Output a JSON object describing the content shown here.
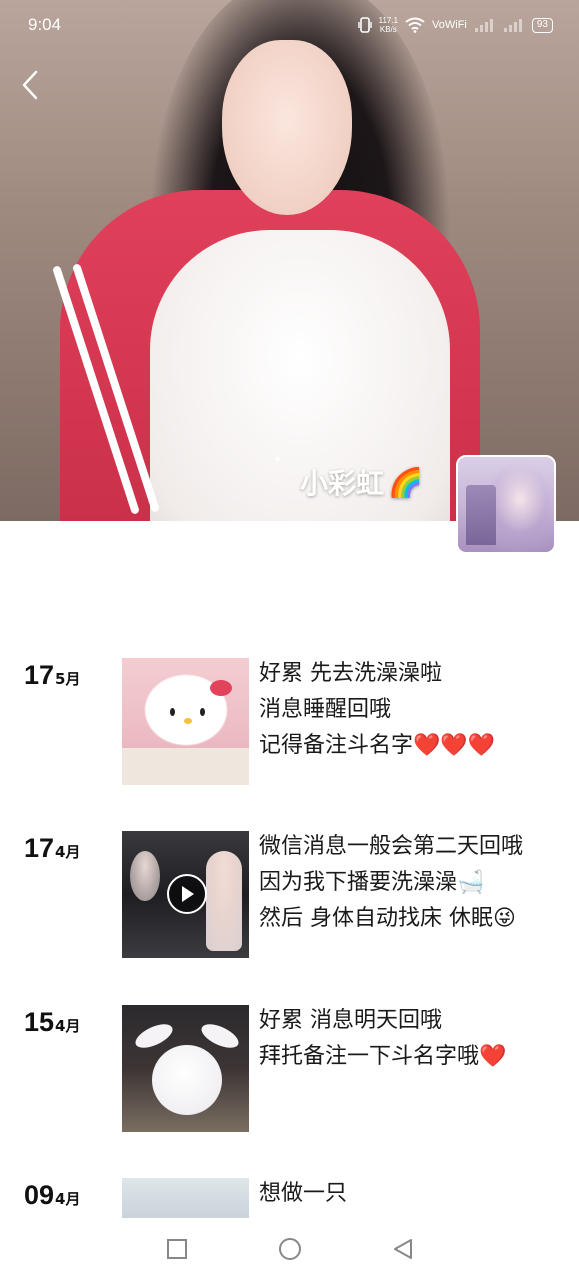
{
  "status_bar": {
    "time": "9:04",
    "network_speed": "117.1",
    "network_speed_unit": "KB/s",
    "wifi_label": "VoWiFi",
    "battery": "93"
  },
  "profile": {
    "name": "小彩虹",
    "name_emoji": "🌈"
  },
  "posts": [
    {
      "day": "17",
      "month": "5月",
      "lines": [
        "好累 先去洗澡澡啦",
        "消息睡醒回哦",
        "记得备注斗名字❤️❤️❤️"
      ]
    },
    {
      "day": "17",
      "month": "4月",
      "lines": [
        "微信消息一般会第二天回哦",
        "因为我下播要洗澡澡🛁",
        "然后 身体自动找床 休眠😜"
      ]
    },
    {
      "day": "15",
      "month": "4月",
      "lines": [
        "好累 消息明天回哦",
        "拜托备注一下斗名字哦❤️"
      ]
    },
    {
      "day": "09",
      "month": "4月",
      "lines": [
        "想做一只"
      ]
    }
  ],
  "icons": {
    "back": "chevron-left-icon",
    "play": "play-icon",
    "nav_recent": "square-icon",
    "nav_home": "circle-icon",
    "nav_back": "triangle-back-icon"
  }
}
